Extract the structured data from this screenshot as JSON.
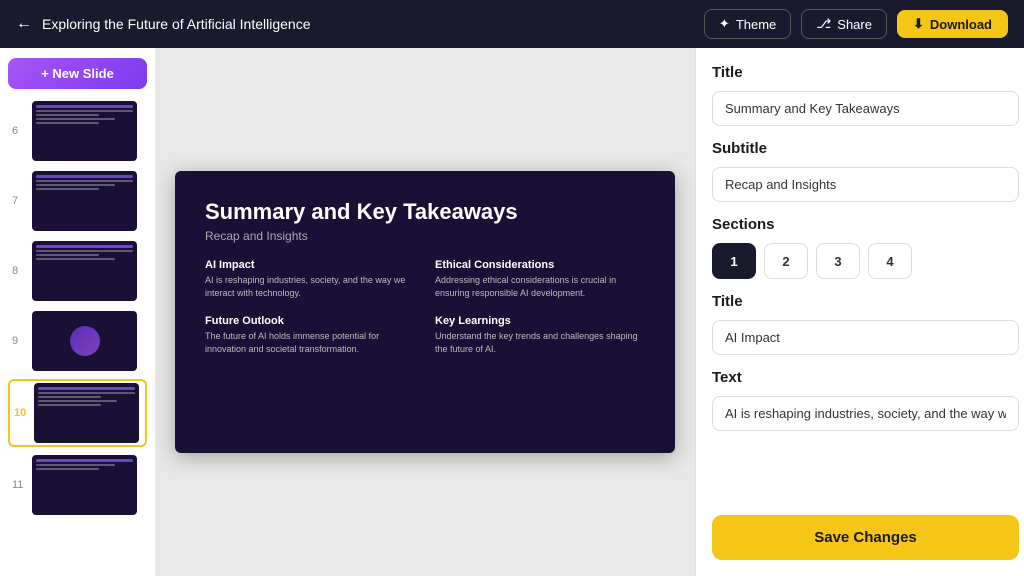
{
  "header": {
    "back_icon": "←",
    "title": "Exploring the Future of Artificial Intelligence",
    "theme_label": "Theme",
    "share_label": "Share",
    "download_label": "Download"
  },
  "sidebar": {
    "new_slide_label": "+ New Slide",
    "slides": [
      {
        "num": "6"
      },
      {
        "num": "7"
      },
      {
        "num": "8"
      },
      {
        "num": "9"
      },
      {
        "num": "10",
        "active": true
      },
      {
        "num": "11"
      }
    ]
  },
  "slide": {
    "title": "Summary and Key Takeaways",
    "subtitle": "Recap and Insights",
    "sections": [
      {
        "title": "AI Impact",
        "text": "AI is reshaping industries, society, and the way we interact with technology."
      },
      {
        "title": "Ethical Considerations",
        "text": "Addressing ethical considerations is crucial in ensuring responsible AI development."
      },
      {
        "title": "Future Outlook",
        "text": "The future of AI holds immense potential for innovation and societal transformation."
      },
      {
        "title": "Key Learnings",
        "text": "Understand the key trends and challenges shaping the future of AI."
      }
    ]
  },
  "right_panel": {
    "title_label": "Title",
    "title_value": "Summary and Key Takeaways",
    "subtitle_label": "Subtitle",
    "subtitle_value": "Recap and Insights",
    "sections_label": "Sections",
    "section_buttons": [
      "1",
      "2",
      "3",
      "4"
    ],
    "active_section": 0,
    "section_title_label": "Title",
    "section_title_value": "AI Impact",
    "section_text_label": "Text",
    "section_text_value": "AI is reshaping industries, society, and the way we",
    "save_label": "Save Changes"
  }
}
